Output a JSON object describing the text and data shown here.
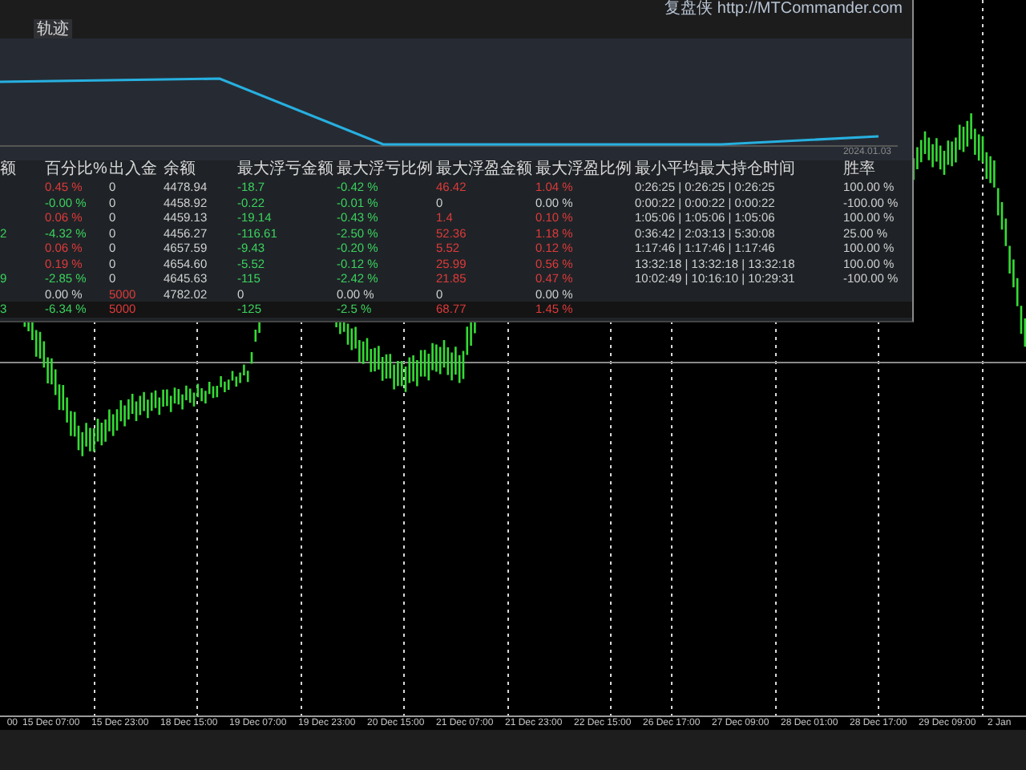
{
  "panel": {
    "brand": "复盘侠 http://MTCommander.com",
    "tabs": [
      {
        "label": "轨迹",
        "selected": true
      }
    ],
    "equity_curve": {
      "date_label": "2024.01.03"
    },
    "table": {
      "columns": [
        "额",
        "百分比%",
        "出入金",
        "余额",
        "最大浮亏金额",
        "最大浮亏比例",
        "最大浮盈金额",
        "最大浮盈比例",
        "最小平均最大持仓时间",
        "胜率"
      ],
      "rows": [
        {
          "kind": "entry",
          "cells": [
            null,
            {
              "text": "0.45 %",
              "color": "#e03a3a"
            },
            {
              "text": "0",
              "color": "#d0d0d0"
            },
            {
              "text": "4478.94",
              "color": "#d0d0d0"
            },
            {
              "text": "-18.7",
              "color": "#3bd35e"
            },
            {
              "text": "-0.42 %",
              "color": "#3bd35e"
            },
            {
              "text": "46.42",
              "color": "#e03a3a"
            },
            {
              "text": "1.04 %",
              "color": "#e03a3a"
            },
            {
              "text": "0:26:25 | 0:26:25 | 0:26:25",
              "color": "#d0d0d0"
            },
            {
              "text": "100.00 %",
              "color": "#d0d0d0"
            }
          ]
        },
        {
          "kind": "entry",
          "cells": [
            null,
            {
              "text": "-0.00 %",
              "color": "#3bd35e"
            },
            {
              "text": "0",
              "color": "#d0d0d0"
            },
            {
              "text": "4458.92",
              "color": "#d0d0d0"
            },
            {
              "text": "-0.22",
              "color": "#3bd35e"
            },
            {
              "text": "-0.01 %",
              "color": "#3bd35e"
            },
            {
              "text": "0",
              "color": "#d0d0d0"
            },
            {
              "text": "0.00 %",
              "color": "#d0d0d0"
            },
            {
              "text": "0:00:22 | 0:00:22 | 0:00:22",
              "color": "#d0d0d0"
            },
            {
              "text": "-100.00 %",
              "color": "#d0d0d0"
            }
          ]
        },
        {
          "kind": "entry",
          "cells": [
            null,
            {
              "text": "0.06 %",
              "color": "#e03a3a"
            },
            {
              "text": "0",
              "color": "#d0d0d0"
            },
            {
              "text": "4459.13",
              "color": "#d0d0d0"
            },
            {
              "text": "-19.14",
              "color": "#3bd35e"
            },
            {
              "text": "-0.43 %",
              "color": "#3bd35e"
            },
            {
              "text": "1.4",
              "color": "#e03a3a"
            },
            {
              "text": "0.10 %",
              "color": "#e03a3a"
            },
            {
              "text": "1:05:06 | 1:05:06 | 1:05:06",
              "color": "#d0d0d0"
            },
            {
              "text": "100.00 %",
              "color": "#d0d0d0"
            }
          ]
        },
        {
          "kind": "entry",
          "cells": [
            {
              "text": "2",
              "color": "#3bd35e"
            },
            {
              "text": "-4.32 %",
              "color": "#3bd35e"
            },
            {
              "text": "0",
              "color": "#d0d0d0"
            },
            {
              "text": "4456.27",
              "color": "#d0d0d0"
            },
            {
              "text": "-116.61",
              "color": "#3bd35e"
            },
            {
              "text": "-2.50 %",
              "color": "#3bd35e"
            },
            {
              "text": "52.36",
              "color": "#e03a3a"
            },
            {
              "text": "1.18 %",
              "color": "#e03a3a"
            },
            {
              "text": "0:36:42 | 2:03:13 | 5:30:08",
              "color": "#d0d0d0"
            },
            {
              "text": "25.00 %",
              "color": "#d0d0d0"
            }
          ]
        },
        {
          "kind": "entry",
          "cells": [
            null,
            {
              "text": "0.06 %",
              "color": "#e03a3a"
            },
            {
              "text": "0",
              "color": "#d0d0d0"
            },
            {
              "text": "4657.59",
              "color": "#d0d0d0"
            },
            {
              "text": "-9.43",
              "color": "#3bd35e"
            },
            {
              "text": "-0.20 %",
              "color": "#3bd35e"
            },
            {
              "text": "5.52",
              "color": "#e03a3a"
            },
            {
              "text": "0.12 %",
              "color": "#e03a3a"
            },
            {
              "text": "1:17:46 | 1:17:46 | 1:17:46",
              "color": "#d0d0d0"
            },
            {
              "text": "100.00 %",
              "color": "#d0d0d0"
            }
          ]
        },
        {
          "kind": "entry",
          "cells": [
            null,
            {
              "text": "0.19 %",
              "color": "#e03a3a"
            },
            {
              "text": "0",
              "color": "#d0d0d0"
            },
            {
              "text": "4654.60",
              "color": "#d0d0d0"
            },
            {
              "text": "-5.52",
              "color": "#3bd35e"
            },
            {
              "text": "-0.12 %",
              "color": "#3bd35e"
            },
            {
              "text": "25.99",
              "color": "#e03a3a"
            },
            {
              "text": "0.56 %",
              "color": "#e03a3a"
            },
            {
              "text": "13:32:18 | 13:32:18 | 13:32:18",
              "color": "#d0d0d0"
            },
            {
              "text": "100.00 %",
              "color": "#d0d0d0"
            }
          ]
        },
        {
          "kind": "entry",
          "cells": [
            {
              "text": "9",
              "color": "#3bd35e"
            },
            {
              "text": "-2.85 %",
              "color": "#3bd35e"
            },
            {
              "text": "0",
              "color": "#d0d0d0"
            },
            {
              "text": "4645.63",
              "color": "#d0d0d0"
            },
            {
              "text": "-115",
              "color": "#3bd35e"
            },
            {
              "text": "-2.42 %",
              "color": "#3bd35e"
            },
            {
              "text": "21.85",
              "color": "#e03a3a"
            },
            {
              "text": "0.47 %",
              "color": "#e03a3a"
            },
            {
              "text": "10:02:49 | 10:16:10 | 10:29:31",
              "color": "#d0d0d0"
            },
            {
              "text": "-100.00 %",
              "color": "#d0d0d0"
            }
          ]
        },
        {
          "kind": "entry",
          "cells": [
            null,
            {
              "text": "0.00 %",
              "color": "#d0d0d0"
            },
            {
              "text": "5000",
              "color": "#e03a3a"
            },
            {
              "text": "4782.02",
              "color": "#d0d0d0"
            },
            {
              "text": "0",
              "color": "#d0d0d0"
            },
            {
              "text": "0.00 %",
              "color": "#d0d0d0"
            },
            {
              "text": "0",
              "color": "#d0d0d0"
            },
            {
              "text": "0.00 %",
              "color": "#d0d0d0"
            },
            null,
            null
          ]
        },
        {
          "kind": "total",
          "cells": [
            {
              "text": "3",
              "color": "#3bd35e"
            },
            {
              "text": "-6.34 %",
              "color": "#3bd35e"
            },
            {
              "text": "5000",
              "color": "#e03a3a"
            },
            null,
            {
              "text": "-125",
              "color": "#3bd35e"
            },
            {
              "text": "-2.5 %",
              "color": "#3bd35e"
            },
            {
              "text": "68.77",
              "color": "#e03a3a"
            },
            {
              "text": "1.45 %",
              "color": "#e03a3a"
            },
            null,
            null
          ]
        }
      ]
    }
  },
  "time_axis": {
    "labels": [
      "00",
      "15 Dec 07:00",
      "15 Dec 23:00",
      "18 Dec 15:00",
      "19 Dec 07:00",
      "19 Dec 23:00",
      "20 Dec 15:00",
      "21 Dec 07:00",
      "21 Dec 23:00",
      "22 Dec 15:00",
      "26 Dec 17:00",
      "27 Dec 09:00",
      "28 Dec 01:00",
      "28 Dec 17:00",
      "29 Dec 09:00",
      "2 Jan"
    ]
  }
}
